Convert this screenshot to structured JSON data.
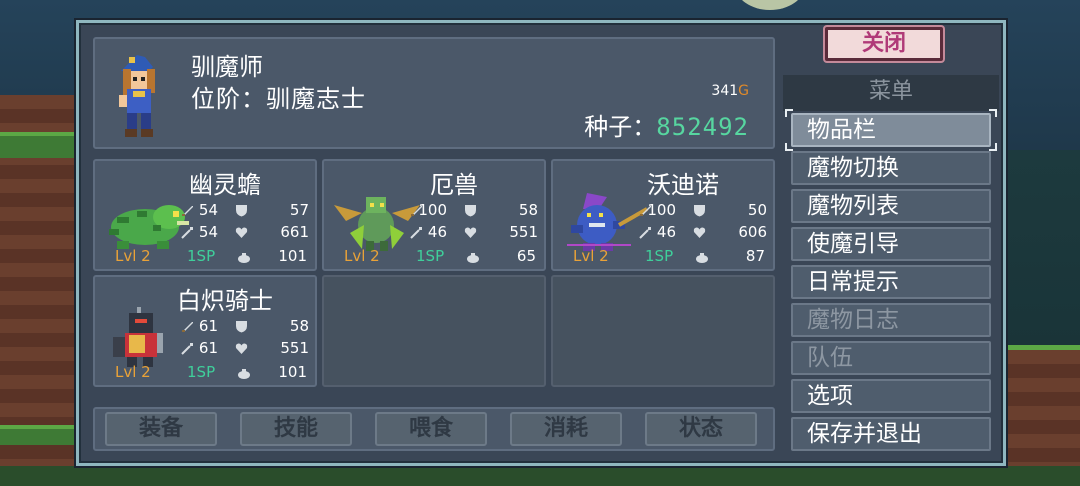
{
  "player": {
    "name": "驯魔师",
    "rank": "位阶：驯魔志士",
    "gold": "341",
    "gold_unit": "G",
    "seed_label": "种子：",
    "seed_value": "852492"
  },
  "monsters": [
    {
      "name": "幽灵蟾",
      "atk": "54",
      "def": "57",
      "matk": "54",
      "hp": "661",
      "level": "Lvl 2",
      "sp": "1SP",
      "cap": "101"
    },
    {
      "name": "厄兽",
      "atk": "100",
      "def": "58",
      "matk": "46",
      "hp": "551",
      "level": "Lvl 2",
      "sp": "1SP",
      "cap": "65"
    },
    {
      "name": "沃迪诺",
      "atk": "100",
      "def": "50",
      "matk": "46",
      "hp": "606",
      "level": "Lvl 2",
      "sp": "1SP",
      "cap": "87"
    },
    {
      "name": "白炽骑士",
      "atk": "61",
      "def": "58",
      "matk": "61",
      "hp": "551",
      "level": "Lvl 2",
      "sp": "1SP",
      "cap": "101"
    }
  ],
  "tabs": [
    "装备",
    "技能",
    "喂食",
    "消耗",
    "状态"
  ],
  "close_label": "关闭",
  "menu": {
    "title": "菜单",
    "items": [
      {
        "label": "物品栏",
        "state": "selected"
      },
      {
        "label": "魔物切换",
        "state": "normal"
      },
      {
        "label": "魔物列表",
        "state": "normal"
      },
      {
        "label": "使魔引导",
        "state": "normal"
      },
      {
        "label": "日常提示",
        "state": "normal"
      },
      {
        "label": "魔物日志",
        "state": "disabled"
      },
      {
        "label": "队伍",
        "state": "disabled"
      },
      {
        "label": "选项",
        "state": "normal"
      },
      {
        "label": "保存并退出",
        "state": "normal"
      }
    ]
  },
  "colors": {
    "seed": "#57d6a0",
    "level": "#e9a238",
    "sp": "#3fcf9b",
    "close_text": "#b03a78",
    "gold_unit": "#e08a2a"
  },
  "icons": {
    "stat_attack": "sword-icon",
    "stat_magic": "wand-icon",
    "stat_defense": "shield-icon",
    "stat_health": "heart-icon",
    "capacity": "sack-icon"
  }
}
